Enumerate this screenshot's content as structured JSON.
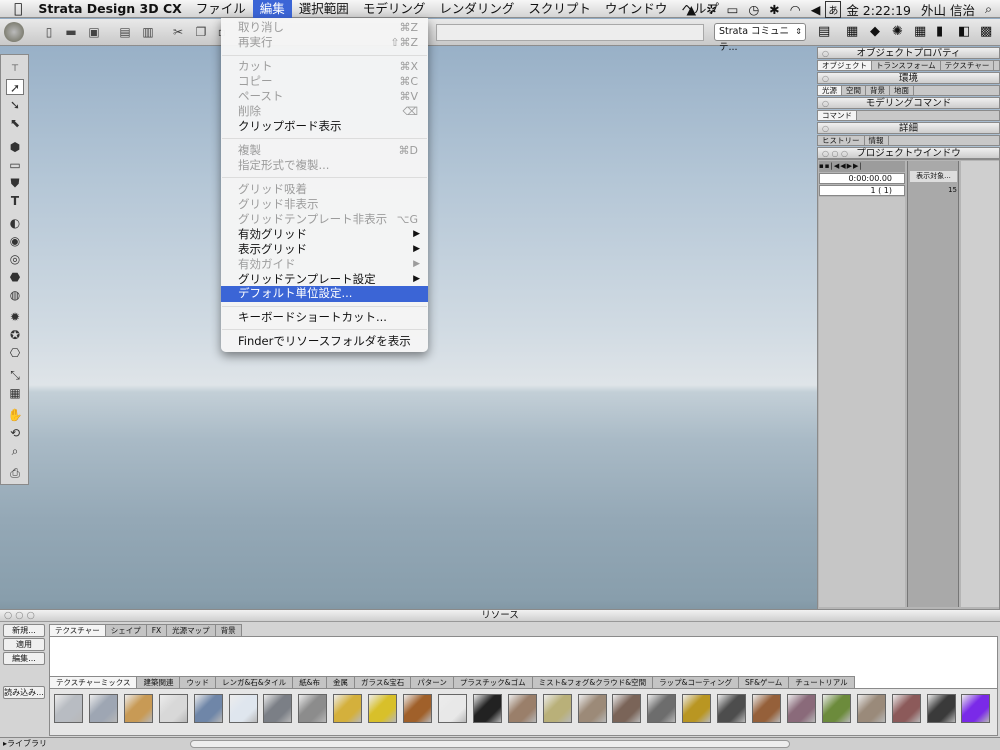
{
  "menubar": {
    "app": "Strata Design 3D CX",
    "items": [
      "ファイル",
      "編集",
      "選択範囲",
      "モデリング",
      "レンダリング",
      "スクリプト",
      "ウインドウ",
      "ヘルプ"
    ],
    "active_index": 1,
    "input_mode": "あ",
    "clock": "金 2:22:19",
    "user": "外山 信治"
  },
  "toolbar": {
    "combo_value": "Strata コミュニテ..."
  },
  "edit_menu": {
    "items": [
      {
        "label": "取り消し",
        "shortcut": "⌘Z",
        "enabled": false
      },
      {
        "label": "再実行",
        "shortcut": "⇧⌘Z",
        "enabled": false
      },
      {
        "label": "カット",
        "shortcut": "⌘X",
        "enabled": false
      },
      {
        "label": "コピー",
        "shortcut": "⌘C",
        "enabled": false
      },
      {
        "label": "ペースト",
        "shortcut": "⌘V",
        "enabled": false
      },
      {
        "label": "削除",
        "shortcut": "⌫",
        "enabled": false
      },
      {
        "label": "クリップボード表示",
        "shortcut": "",
        "enabled": true
      },
      {
        "label": "複製",
        "shortcut": "⌘D",
        "enabled": false
      },
      {
        "label": "指定形式で複製...",
        "shortcut": "",
        "enabled": false
      },
      {
        "label": "グリッド吸着",
        "shortcut": "",
        "enabled": false
      },
      {
        "label": "グリッド非表示",
        "shortcut": "",
        "enabled": false
      },
      {
        "label": "グリッドテンプレート非表示",
        "shortcut": "⌥G",
        "enabled": false
      },
      {
        "label": "有効グリッド",
        "shortcut": "▶",
        "enabled": true
      },
      {
        "label": "表示グリッド",
        "shortcut": "▶",
        "enabled": true
      },
      {
        "label": "有効ガイド",
        "shortcut": "▶",
        "enabled": false
      },
      {
        "label": "グリッドテンプレート設定",
        "shortcut": "▶",
        "enabled": true
      },
      {
        "label": "デフォルト単位設定...",
        "shortcut": "",
        "enabled": true,
        "highlighted": true
      },
      {
        "label": "キーボードショートカット...",
        "shortcut": "",
        "enabled": true
      },
      {
        "label": "Finderでリソースフォルダを表示",
        "shortcut": "",
        "enabled": true
      }
    ]
  },
  "right_panel": {
    "object_props_title": "オブジェクトプロパティ",
    "object_tabs": [
      "オブジェクト",
      "トランスフォーム",
      "テクスチャー"
    ],
    "env_title": "環境",
    "env_tabs": [
      "光源",
      "空間",
      "背景",
      "地面"
    ],
    "modeling_title": "モデリングコマンド",
    "command_tab": "コマンド",
    "detail_title": "詳細",
    "history_tabs": [
      "ヒストリー",
      "情報"
    ],
    "project_title": "プロジェクトウインドウ",
    "time_value": "0:00:00.00",
    "frame_value": "1 ( 1)",
    "show_objects": "表示対象...",
    "frame_rate": "15"
  },
  "resources": {
    "title": "リソース",
    "buttons": [
      "新規...",
      "適用",
      "編集...",
      "読み込み..."
    ],
    "tabs": [
      "テクスチャー",
      "シェイプ",
      "FX",
      "光源マップ",
      "背景"
    ],
    "categories": [
      "テクスチャーミックス",
      "建築関連",
      "ウッド",
      "レンガ&石&タイル",
      "紙&布",
      "金属",
      "ガラス&宝石",
      "パターン",
      "プラスチック&ゴム",
      "ミスト&フォグ&クラウド&空間",
      "ラップ&コーティング",
      "SF&ゲーム",
      "チュートリアル"
    ],
    "library": "▸ライブラリ"
  },
  "swatch_colors": [
    "#b8bcc2",
    "#9ea6b3",
    "#c89a55",
    "#d8d8d8",
    "#6f86a8",
    "#dfe6ee",
    "#7b7f86",
    "#8c8c8c",
    "#d4b03c",
    "#d8c02a",
    "#a0602a",
    "#e8e8e8",
    "#222222",
    "#9a7f6a",
    "#b9b079",
    "#9c8a78",
    "#7a6458",
    "#6d6d6d",
    "#b99622",
    "#4d4d4d",
    "#95603a",
    "#8a6a7a",
    "#6c8b3c",
    "#9a8a7a",
    "#8c5a5a",
    "#3a3a3a",
    "#7a2ae8"
  ]
}
